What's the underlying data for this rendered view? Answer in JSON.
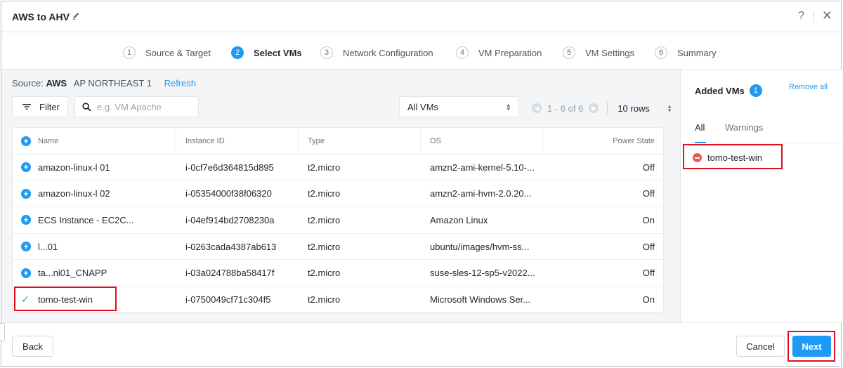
{
  "window": {
    "title": "AWS to AHV",
    "help": "?",
    "close": "✕"
  },
  "steps": [
    {
      "num": "1",
      "label": "Source & Target"
    },
    {
      "num": "2",
      "label": "Select VMs"
    },
    {
      "num": "3",
      "label": "Network Configuration"
    },
    {
      "num": "4",
      "label": "VM Preparation"
    },
    {
      "num": "5",
      "label": "VM Settings"
    },
    {
      "num": "6",
      "label": "Summary"
    }
  ],
  "source": {
    "label": "Source:",
    "provider": "AWS",
    "region": "AP NORTHEAST 1",
    "refresh": "Refresh"
  },
  "toolbar": {
    "filter_label": "Filter",
    "search_placeholder": "e.g. VM Apache",
    "vm_select": "All VMs",
    "page_range": "1 - 6 of 6",
    "rows_select": "10 rows"
  },
  "table": {
    "columns": [
      "Name",
      "Instance ID",
      "Type",
      "OS",
      "Power State"
    ],
    "rows": [
      {
        "name": "amazon-linux-l      01",
        "id": "i-0cf7e6d364815d895",
        "type": "t2.micro",
        "os": "amzn2-ami-kernel-5.10-...",
        "power": "Off",
        "added": false
      },
      {
        "name": "amazon-linux-l      02",
        "id": "i-05354000f38f06320",
        "type": "t2.micro",
        "os": "amzn2-ami-hvm-2.0.20...",
        "power": "Off",
        "added": false
      },
      {
        "name": "ECS Instance - EC2C...",
        "id": "i-04ef914bd2708230a",
        "type": "t2.micro",
        "os": "Amazon Linux",
        "power": "On",
        "added": false
      },
      {
        "name": "l...01",
        "id": "i-0263cada4387ab613",
        "type": "t2.micro",
        "os": "ubuntu/images/hvm-ss...",
        "power": "Off",
        "added": false
      },
      {
        "name": "ta...ni01_CNAPP",
        "id": "i-03a024788ba58417f",
        "type": "t2.micro",
        "os": "suse-sles-12-sp5-v2022...",
        "power": "Off",
        "added": false
      },
      {
        "name": "tomo-test-win",
        "id": "i-0750049cf71c304f5",
        "type": "t2.micro",
        "os": "Microsoft Windows Ser...",
        "power": "On",
        "added": true
      }
    ]
  },
  "added": {
    "title": "Added VMs",
    "count": "1",
    "remove_all": "Remove all",
    "tabs": [
      "All",
      "Warnings"
    ],
    "items": [
      "tomo-test-win"
    ]
  },
  "footer": {
    "back": "Back",
    "cancel": "Cancel",
    "next": "Next"
  },
  "colors": {
    "accent": "#1d9af3",
    "highlight": "#e10e1e",
    "success": "#23b26a",
    "remove": "#e35a5a"
  }
}
